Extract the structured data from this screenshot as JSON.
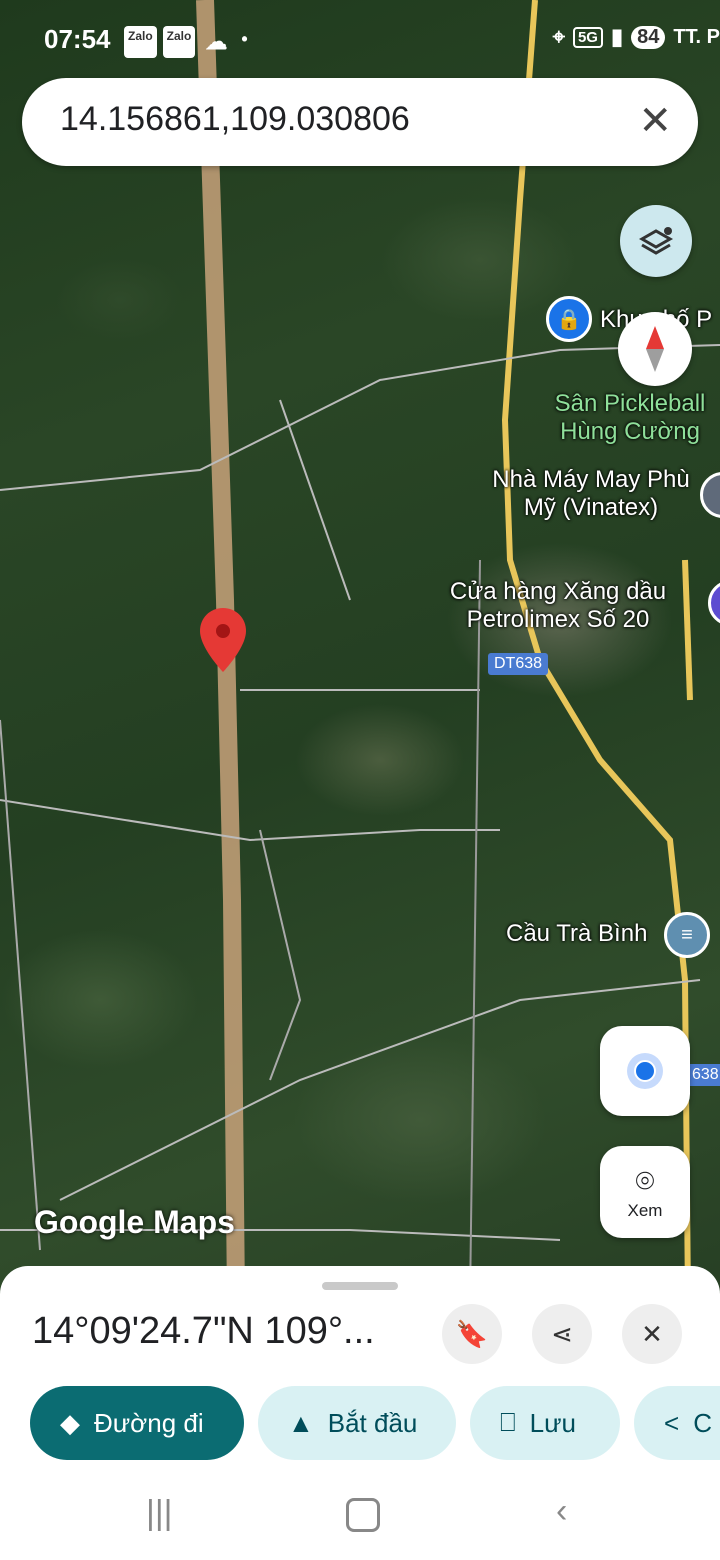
{
  "status_bar": {
    "time": "07:54",
    "app_icons": [
      "Zalo",
      "Zalo"
    ],
    "signal": "5G",
    "battery": "84",
    "carrier_partial": "TT. P"
  },
  "search": {
    "query": "14.156861,109.030806"
  },
  "map": {
    "places": [
      {
        "name": "Khu phố P",
        "partial": true,
        "icon": "lock-pin-icon"
      },
      {
        "name": "Sân Pickleball Hùng Cường",
        "icon": "none"
      },
      {
        "name": "Nhà Máy May Phù Mỹ (Vinatex)",
        "icon": "clothing-pin-icon"
      },
      {
        "name": "Cửa hàng Xăng dầu Petrolimex Số 20",
        "icon": "gas-station-icon"
      },
      {
        "name": "Cầu Trà Bình",
        "icon": "bridge-icon"
      }
    ],
    "road_labels": [
      "DT638",
      "638"
    ],
    "watermark": "Google Maps"
  },
  "controls": {
    "look_label": "Xem"
  },
  "sheet": {
    "coordinates": "14°09'24.7\"N 109°...",
    "chips": [
      {
        "label": "Đường đi",
        "icon": "directions-icon"
      },
      {
        "label": "Bắt đầu",
        "icon": "navigation-arrow-icon"
      },
      {
        "label": "Lưu",
        "icon": "bookmark-icon"
      },
      {
        "label": "C",
        "icon": "share-icon"
      }
    ]
  },
  "colors": {
    "primary": "#0b6c72",
    "chip_bg": "#d9f1f3",
    "road": "#e8c65a",
    "pin_red": "#e53935"
  }
}
